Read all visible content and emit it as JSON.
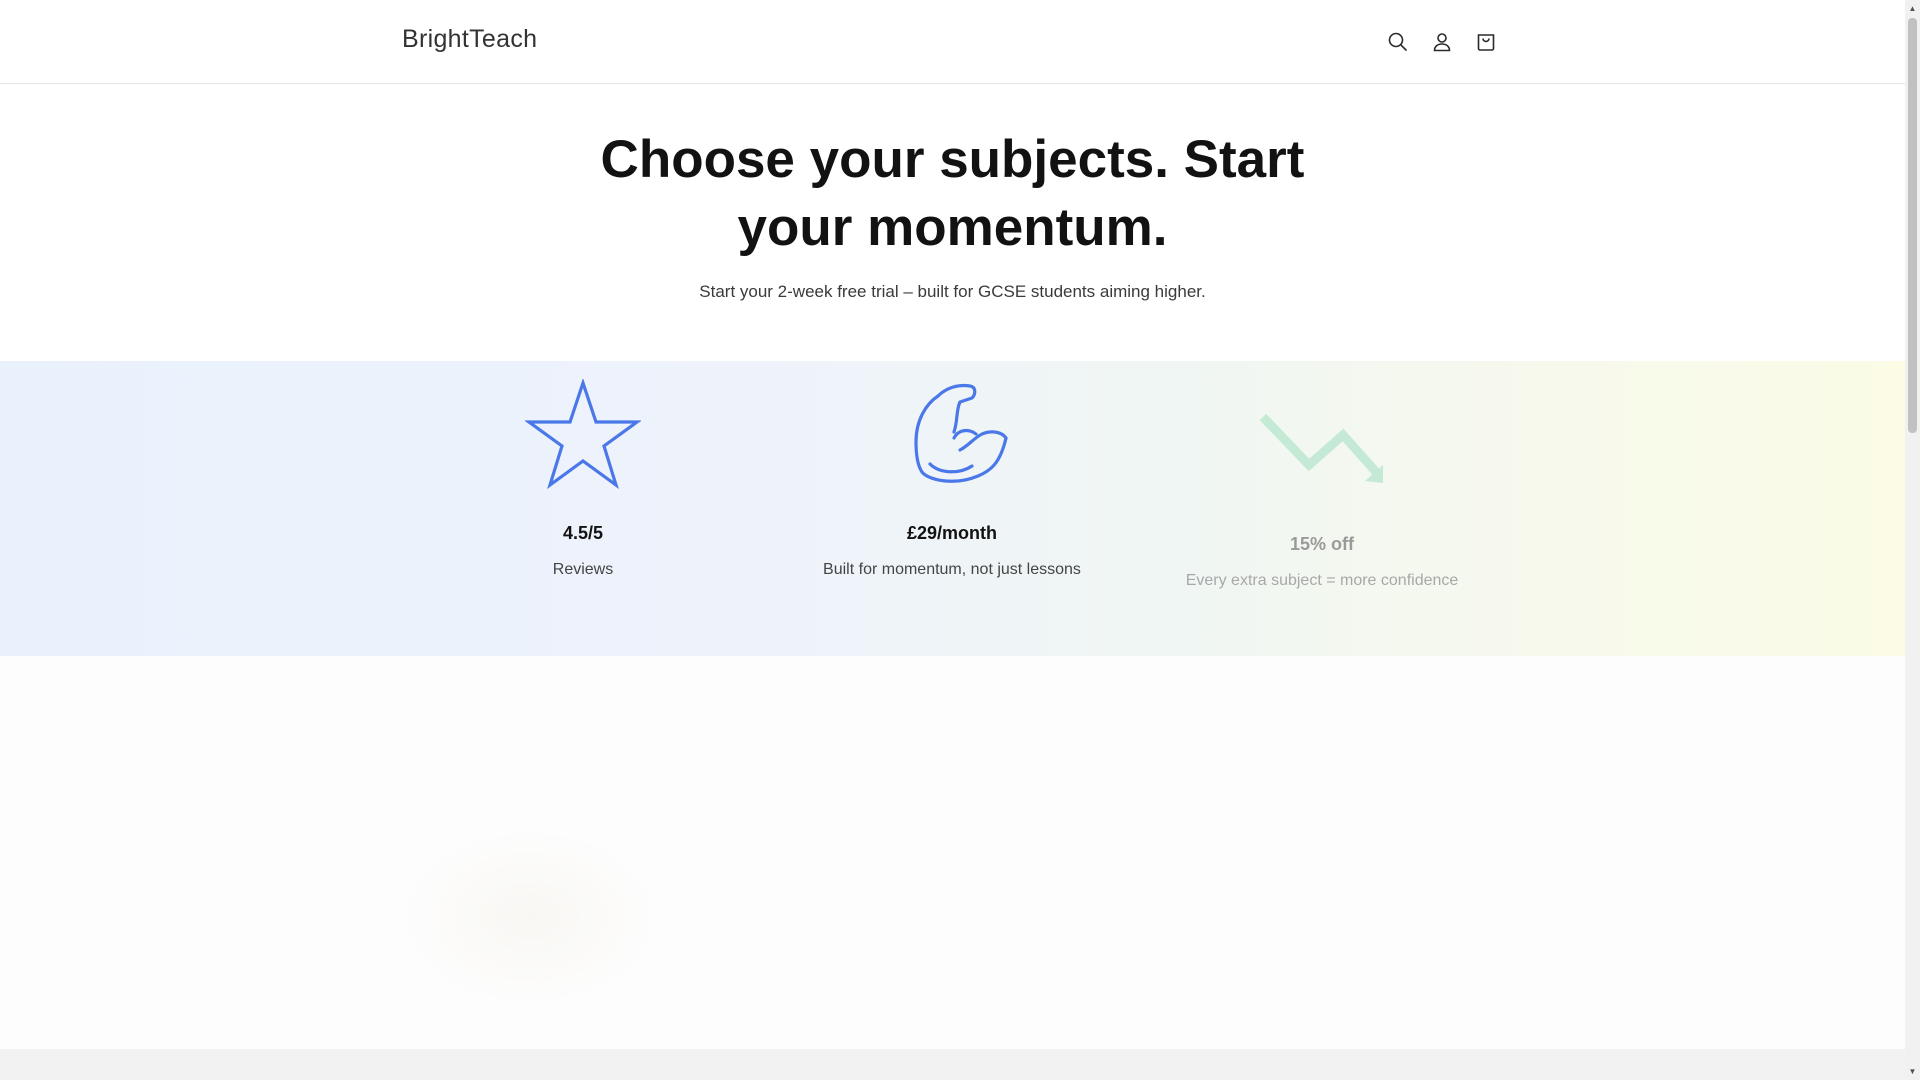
{
  "header": {
    "logo": "BrightTeach",
    "icons": [
      "search-icon",
      "account-icon",
      "cart-icon"
    ]
  },
  "hero": {
    "title": "Choose your subjects. Start your momentum.",
    "subtitle": "Start your 2-week free trial – built for GCSE students aiming higher."
  },
  "features": [
    {
      "icon": "star-icon",
      "title": "4.5/5",
      "description": "Reviews",
      "color": "#4a78e8"
    },
    {
      "icon": "flexed-bicep-icon",
      "title": "£29/month",
      "description": "Built for momentum, not just lessons",
      "color": "#4a78e8"
    },
    {
      "icon": "trend-down-arrow-icon",
      "title": "15% off",
      "description": "Every extra subject = more confidence",
      "color": "#c4ead6"
    }
  ],
  "colors": {
    "accent": "#4a78e8",
    "band_start": "#e9f1fd",
    "band_end": "#fbfbe6"
  }
}
